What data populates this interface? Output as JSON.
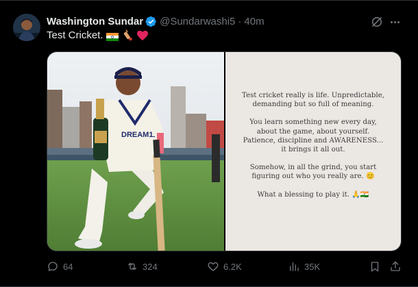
{
  "tweet": {
    "display_name": "Washington Sundar",
    "handle": "@Sundarwashi5",
    "separator": "·",
    "time": "40m",
    "text": "Test Cricket.",
    "emojis": [
      "india-flag-emoji",
      "cricket-bat-emoji",
      "red-heart-emoji"
    ],
    "verified": true
  },
  "media": {
    "photo_caption": "DREAM11",
    "note_paragraphs": [
      [
        "Test cricket really is life. Unpredictable,",
        "demanding but so full of meaning."
      ],
      [
        "You learn something new every day,",
        "about the game, about yourself.",
        "Patience, discipline and AWARENESS...",
        "it brings it all out."
      ],
      [
        "Somehow, in all the grind, you start",
        "figuring out who you really are. 😊"
      ],
      [
        "What a blessing to play it. 🙏🇮🇳"
      ]
    ]
  },
  "actions": {
    "replies": "64",
    "reposts": "324",
    "likes": "6.2K",
    "views": "35K"
  },
  "colors": {
    "background": "#000000",
    "text": "#e7e9ea",
    "muted": "#71767b",
    "verified": "#1d9bf0",
    "heart": "#e0245e"
  }
}
